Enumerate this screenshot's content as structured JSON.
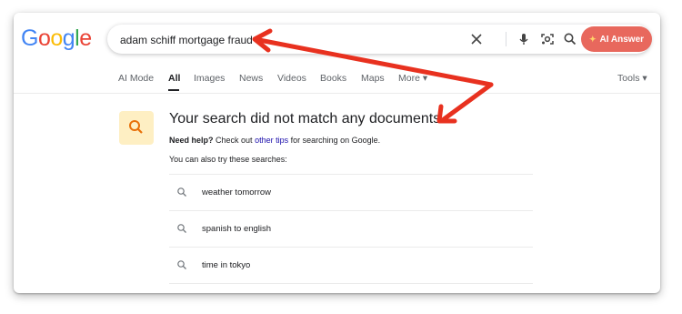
{
  "logo": {
    "letters": [
      "G",
      "o",
      "o",
      "g",
      "l",
      "e"
    ],
    "colors": [
      "#4285f4",
      "#ea4335",
      "#fbbc05",
      "#4285f4",
      "#34a853",
      "#ea4335"
    ]
  },
  "search": {
    "query": "adam schiff mortgage fraud",
    "clear_icon": "close-icon",
    "voice_icon": "microphone-icon",
    "lens_icon": "lens-icon",
    "search_icon": "search-icon",
    "ai_button_label": "AI Answer",
    "ai_button_color": "#e8685d"
  },
  "tabs": [
    {
      "label": "AI Mode",
      "active": false
    },
    {
      "label": "All",
      "active": true
    },
    {
      "label": "Images",
      "active": false
    },
    {
      "label": "News",
      "active": false
    },
    {
      "label": "Videos",
      "active": false
    },
    {
      "label": "Books",
      "active": false
    },
    {
      "label": "Maps",
      "active": false
    },
    {
      "label": "More ▾",
      "active": false
    }
  ],
  "tools_label": "Tools ▾",
  "results": {
    "no_match_title": "Your search did not match any documents",
    "help_bold": "Need help?",
    "help_text_1": "Check out",
    "help_link": "other tips",
    "help_text_2": "for searching on Google.",
    "also_try": "You can also try these searches:",
    "suggestions": [
      "weather tomorrow",
      "spanish to english",
      "time in tokyo"
    ]
  },
  "annotation": {
    "arrow_color": "#e8311f"
  }
}
